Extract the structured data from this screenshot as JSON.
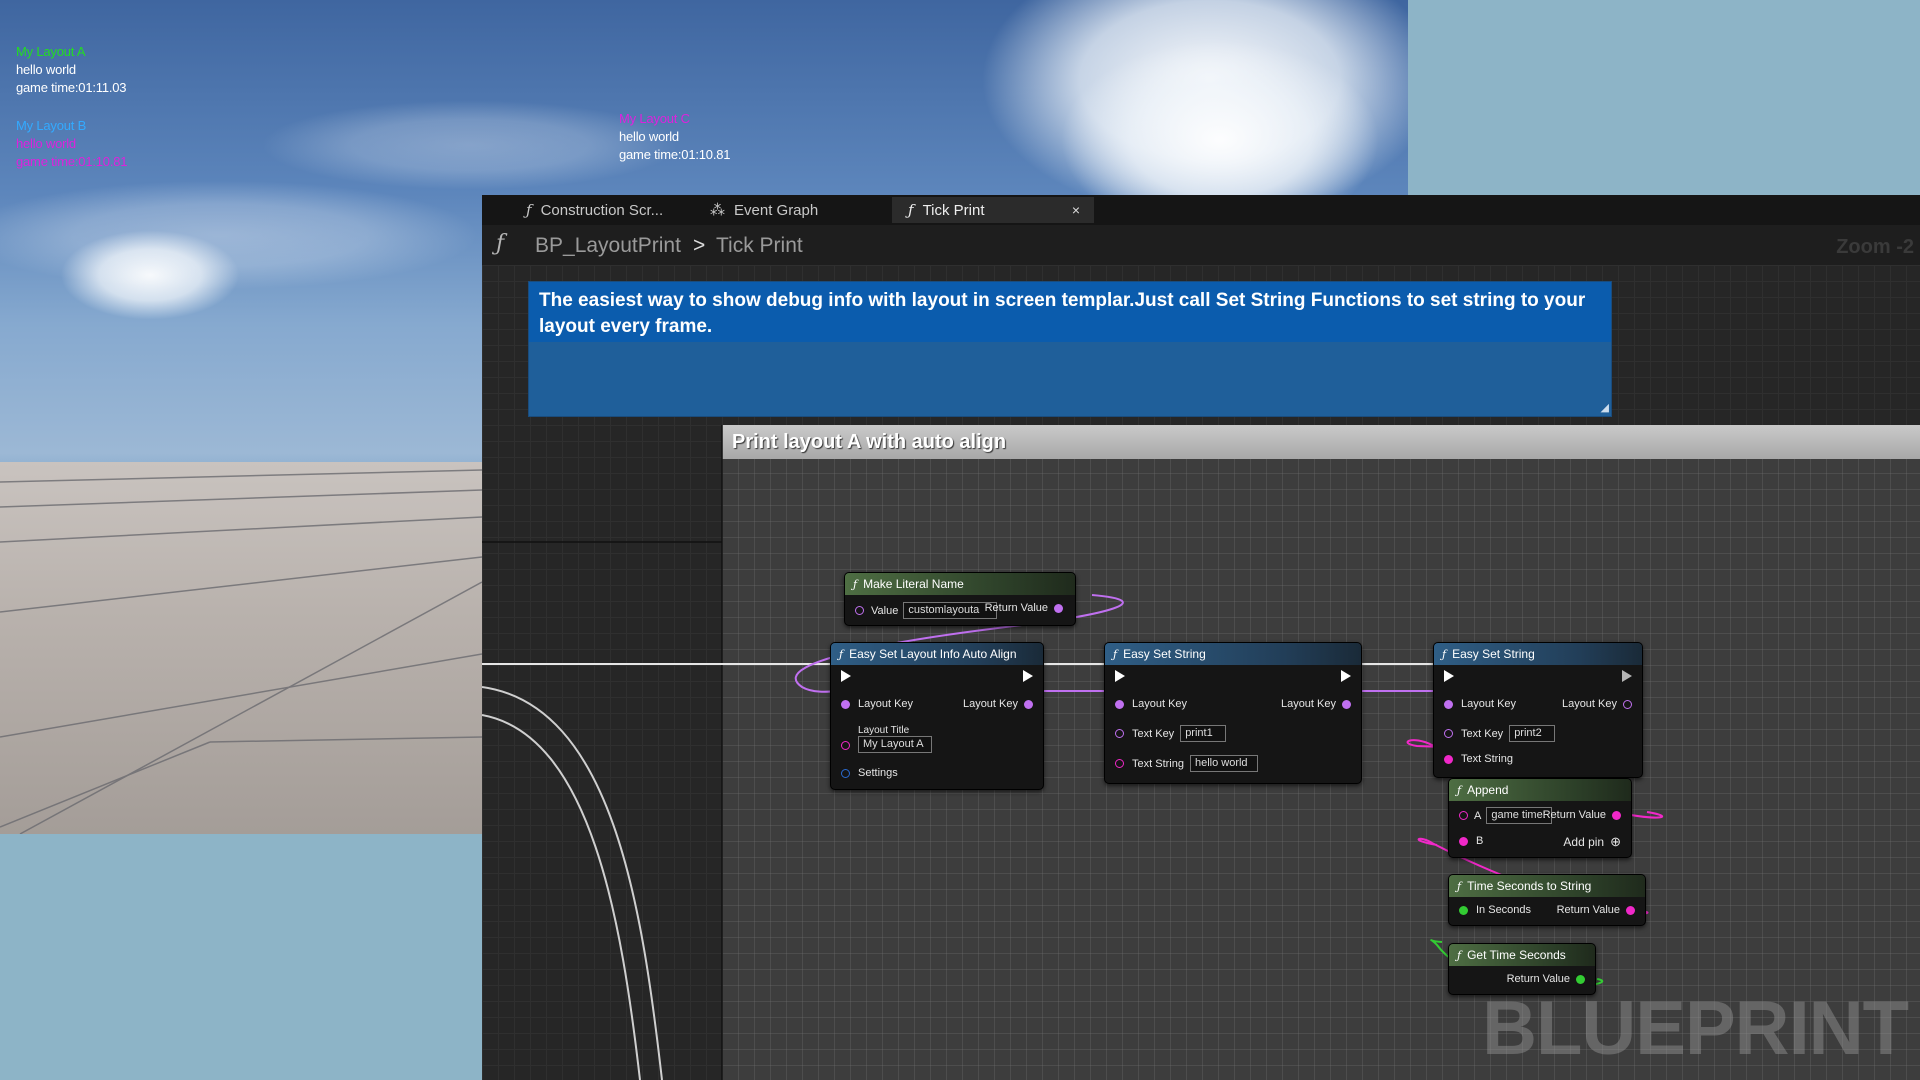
{
  "hud": {
    "layout_a": {
      "title": "My Layout A",
      "line1": "hello world",
      "line2": "game time:01:11.03"
    },
    "layout_b": {
      "title": "My Layout B",
      "line1": "hello world",
      "line2": "game time:01:10.81"
    },
    "layout_c": {
      "title": "My Layout C",
      "line1": "hello world",
      "line2": "game time:01:10.81"
    }
  },
  "tabs": [
    {
      "label": "Construction Scr...",
      "icon": "function-icon"
    },
    {
      "label": "Event Graph",
      "icon": "event-graph-icon"
    },
    {
      "label": "Tick Print",
      "icon": "function-icon",
      "active": true,
      "close": "×"
    }
  ],
  "breadcrumb": {
    "blueprint": "BP_LayoutPrint",
    "separator": ">",
    "function": "Tick Print"
  },
  "zoom": "Zoom -2",
  "comments": {
    "main": "The easiest way to show debug info with layout in screen templar.Just call Set String Functions to set string to your layout every frame.",
    "group": "Print layout A with auto align"
  },
  "nodes": {
    "make_literal_name": {
      "title": "Make Literal Name",
      "value_label": "Value",
      "value": "customlayouta",
      "return_label": "Return Value"
    },
    "auto_align": {
      "title": "Easy Set Layout Info Auto Align",
      "layout_key_in": "Layout Key",
      "layout_key_out": "Layout Key",
      "layout_title_label": "Layout Title",
      "layout_title": "My Layout A",
      "settings": "Settings"
    },
    "set_string_1": {
      "title": "Easy Set String",
      "layout_key_in": "Layout Key",
      "layout_key_out": "Layout Key",
      "text_key_label": "Text Key",
      "text_key": "print1",
      "text_string_label": "Text String",
      "text_string": "hello world"
    },
    "set_string_2": {
      "title": "Easy Set String",
      "layout_key_in": "Layout Key",
      "layout_key_out": "Layout Key",
      "text_key_label": "Text Key",
      "text_key": "print2",
      "text_string_label": "Text String"
    },
    "append": {
      "title": "Append",
      "a_label": "A",
      "a_value": "game time:",
      "b_label": "B",
      "return_label": "Return Value",
      "add_pin": "Add pin"
    },
    "time_to_string": {
      "title": "Time Seconds to String",
      "in_label": "In Seconds",
      "return_label": "Return Value"
    },
    "get_time": {
      "title": "Get Time Seconds",
      "return_label": "Return Value"
    }
  },
  "watermark": "BLUEPRINT",
  "colors": {
    "layout_a": "#22dd22",
    "layout_b": "#33aaff",
    "layout_c": "#dd22dd",
    "pin_name": "#c070f0",
    "pin_string": "#f028c8",
    "pin_float": "#33cc33",
    "pin_struct": "#2a6ad0"
  }
}
